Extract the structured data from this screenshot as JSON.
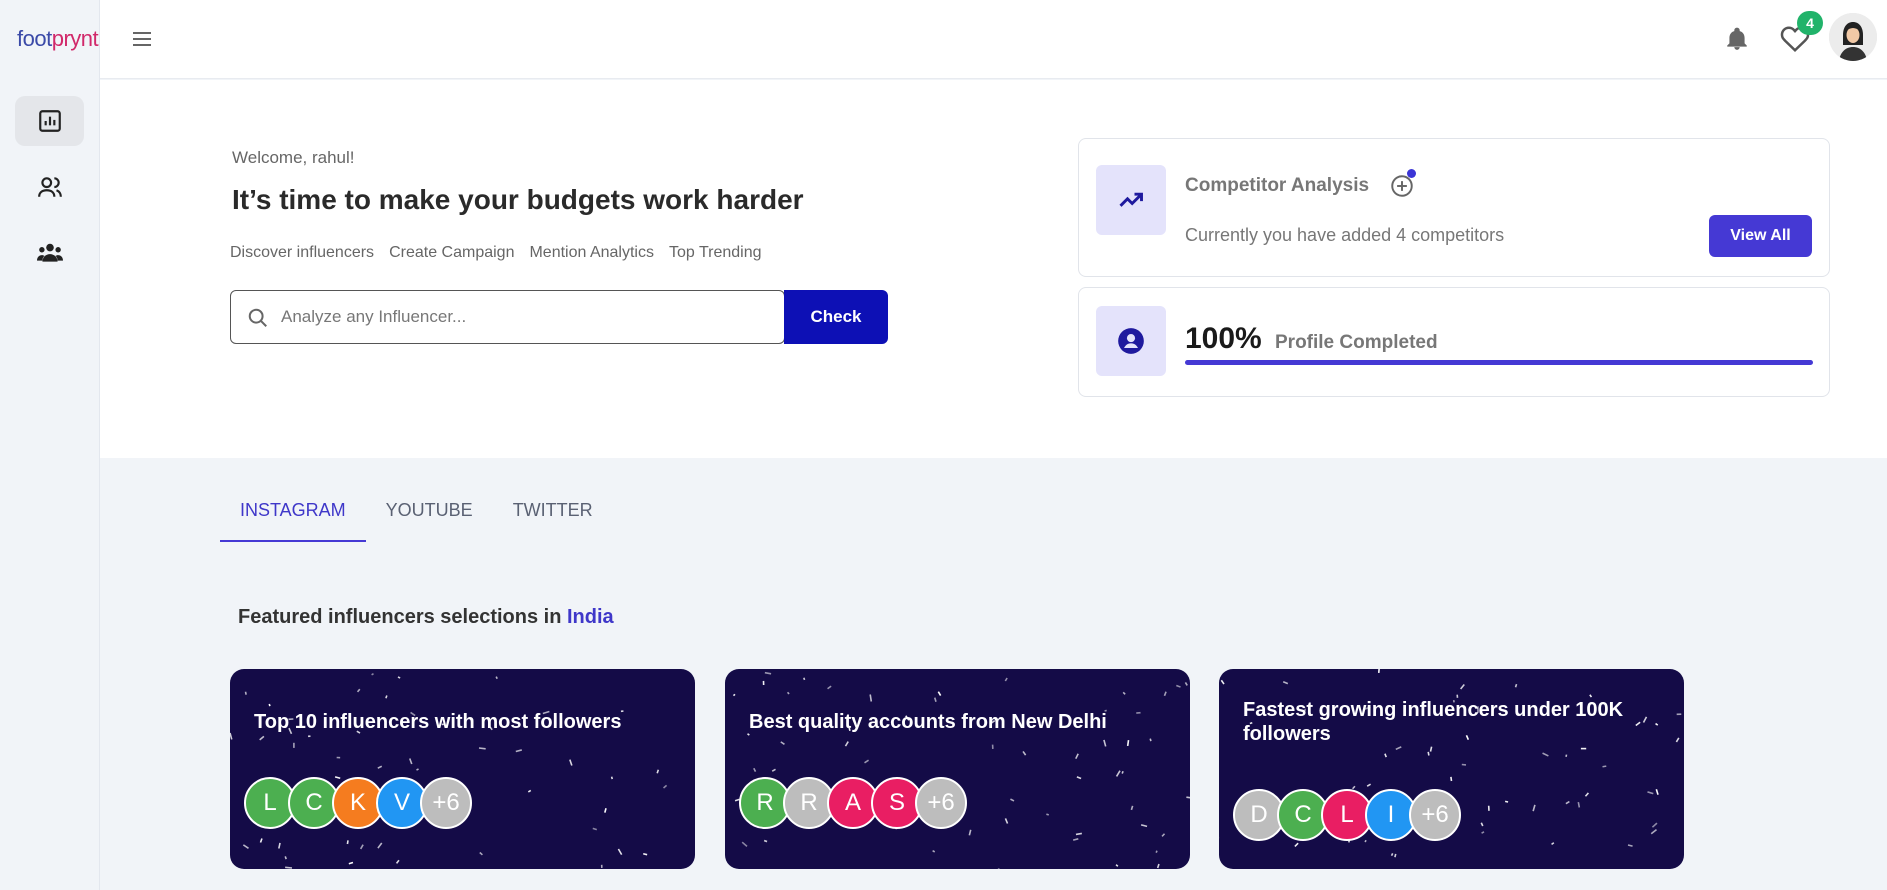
{
  "logo": {
    "part1": "foot",
    "part2": "prynt"
  },
  "header": {
    "notification_count": "4"
  },
  "hero": {
    "welcome": "Welcome, rahul!",
    "headline": "It’s time to make your budgets work harder",
    "links": [
      "Discover influencers",
      "Create Campaign",
      "Mention Analytics",
      "Top Trending"
    ],
    "search_placeholder": "Analyze any Influencer...",
    "check_label": "Check"
  },
  "competitor": {
    "title": "Competitor Analysis",
    "subtitle": "Currently you have added 4 competitors",
    "view_all": "View All"
  },
  "profile": {
    "percent": "100%",
    "label": "Profile Completed",
    "progress": 1.0
  },
  "tabs": [
    "INSTAGRAM",
    "YOUTUBE",
    "TWITTER"
  ],
  "featured": {
    "prefix": "Featured influencers selections in",
    "location": "India"
  },
  "cards": [
    {
      "title": "Top 10 influencers with most followers",
      "avatars": [
        {
          "letter": "L",
          "color": "#4caf50"
        },
        {
          "letter": "C",
          "color": "#4caf50"
        },
        {
          "letter": "K",
          "color": "#f57c1f"
        },
        {
          "letter": "V",
          "color": "#2196f3"
        },
        {
          "letter": "+6",
          "color": "#bdbdbd"
        }
      ]
    },
    {
      "title": "Best quality accounts from New Delhi",
      "avatars": [
        {
          "letter": "R",
          "color": "#4caf50"
        },
        {
          "letter": "R",
          "color": "#bdbdbd"
        },
        {
          "letter": "A",
          "color": "#e91e63"
        },
        {
          "letter": "S",
          "color": "#e91e63"
        },
        {
          "letter": "+6",
          "color": "#bdbdbd"
        }
      ]
    },
    {
      "title": "Fastest growing influencers under 100K followers",
      "avatars": [
        {
          "letter": "D",
          "color": "#bdbdbd"
        },
        {
          "letter": "C",
          "color": "#4caf50"
        },
        {
          "letter": "L",
          "color": "#e91e63"
        },
        {
          "letter": "I",
          "color": "#2196f3"
        },
        {
          "letter": "+6",
          "color": "#bdbdbd"
        }
      ]
    }
  ]
}
